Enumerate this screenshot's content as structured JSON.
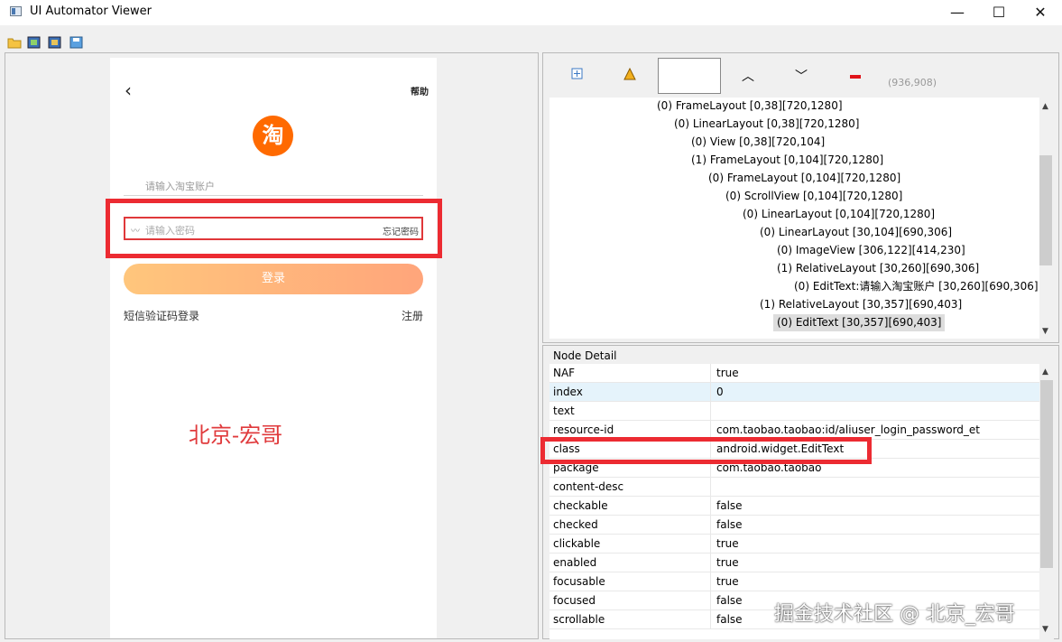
{
  "window": {
    "title": "UI Automator Viewer",
    "minimize": "—",
    "maximize": "☐",
    "close": "✕"
  },
  "toolbar": {
    "icons": [
      "open-folder-icon",
      "screenshot-icon",
      "compressed-screenshot-icon",
      "save-icon"
    ]
  },
  "device": {
    "back": "‹",
    "help": "帮助",
    "logo_char": "淘",
    "account_placeholder": "请输入淘宝账户",
    "password_placeholder": "请输入密码",
    "forgot": "忘记密码",
    "login": "登录",
    "sms_login": "短信验证码登录",
    "register": "注册",
    "watermark": "北京-宏哥"
  },
  "inspector": {
    "coords": "(936,908)",
    "tree": [
      "(0) FrameLayout [0,38][720,1280]",
      "(0) LinearLayout [0,38][720,1280]",
      "(0) View [0,38][720,104]",
      "(1) FrameLayout [0,104][720,1280]",
      "(0) FrameLayout [0,104][720,1280]",
      "(0) ScrollView [0,104][720,1280]",
      "(0) LinearLayout [0,104][720,1280]",
      "(0) LinearLayout [30,104][690,306]",
      "(0) ImageView [306,122][414,230]",
      "(1) RelativeLayout [30,260][690,306]",
      "(0) EditText:请输入淘宝账户 [30,260][690,306]",
      "(1) RelativeLayout [30,357][690,403]",
      "(0) EditText [30,357][690,403]"
    ],
    "node_detail_label": "Node Detail",
    "node_detail": [
      {
        "k": "NAF",
        "v": "true"
      },
      {
        "k": "index",
        "v": "0"
      },
      {
        "k": "text",
        "v": ""
      },
      {
        "k": "resource-id",
        "v": "com.taobao.taobao:id/aliuser_login_password_et"
      },
      {
        "k": "class",
        "v": "android.widget.EditText"
      },
      {
        "k": "package",
        "v": "com.taobao.taobao"
      },
      {
        "k": "content-desc",
        "v": ""
      },
      {
        "k": "checkable",
        "v": "false"
      },
      {
        "k": "checked",
        "v": "false"
      },
      {
        "k": "clickable",
        "v": "true"
      },
      {
        "k": "enabled",
        "v": "true"
      },
      {
        "k": "focusable",
        "v": "true"
      },
      {
        "k": "focused",
        "v": "false"
      },
      {
        "k": "scrollable",
        "v": "false"
      }
    ]
  },
  "watermark2": "掘金技术社区 @ 北京_宏哥"
}
